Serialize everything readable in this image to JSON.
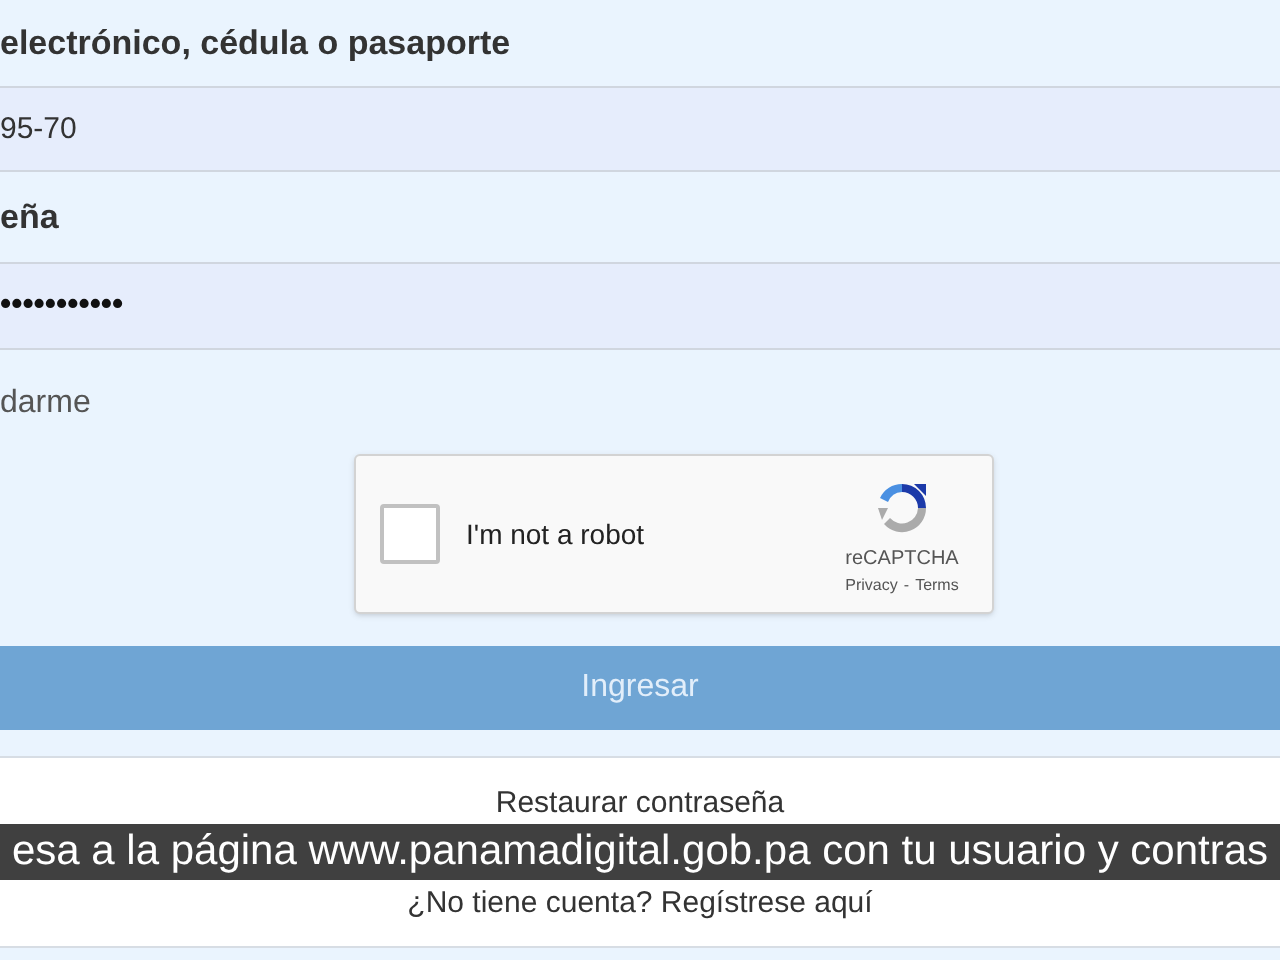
{
  "form": {
    "username_label": "electrónico, cédula o pasaporte",
    "username_value": "95-70",
    "password_label": "eña",
    "password_value": "•••••••••••",
    "remember_label": "darme",
    "captcha": {
      "label": "I'm not a robot",
      "checked": false,
      "brand": "reCAPTCHA",
      "privacy": "Privacy",
      "separator": "-",
      "terms": "Terms"
    },
    "submit_button": "Ingresar",
    "restore_link": "Restaurar contraseña",
    "register_link": "¿No tiene cuenta? Regístrese aquí"
  },
  "caption": "esa a la página www.panamadigital.gob.pa con tu usuario y contras"
}
